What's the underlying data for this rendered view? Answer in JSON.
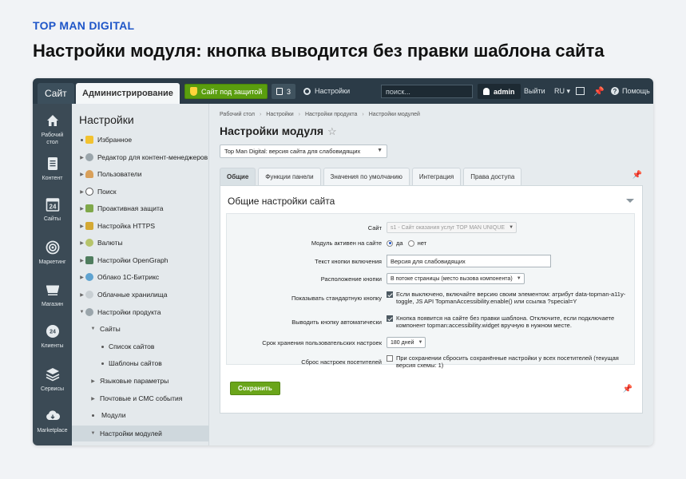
{
  "brand": "TOP MAN DIGITAL",
  "headline": "Настройки модуля: кнопка выводится без правки шаблона сайта",
  "topbar": {
    "site_tab": "Сайт",
    "admin_tab": "Администрирование",
    "secure_button": "Сайт под защитой",
    "notifications_count": "3",
    "settings_link": "Настройки",
    "search_placeholder": "поиск...",
    "user": "admin",
    "logout": "Выйти",
    "lang": "RU",
    "help": "Помощь"
  },
  "rail": [
    {
      "label": "Рабочий стол",
      "icon": "home-icon"
    },
    {
      "label": "Контент",
      "icon": "document-icon"
    },
    {
      "label": "Сайты",
      "icon": "calendar-icon"
    },
    {
      "label": "Маркетинг",
      "icon": "target-icon"
    },
    {
      "label": "Магазин",
      "icon": "cart-icon"
    },
    {
      "label": "Клиенты",
      "icon": "clients-icon"
    },
    {
      "label": "Сервисы",
      "icon": "layers-icon"
    },
    {
      "label": "Marketplace",
      "icon": "cloud-icon"
    }
  ],
  "rail_calendar_day": "24",
  "rail_clients_badge": "24",
  "menu": {
    "title": "Настройки",
    "items": [
      {
        "label": "Избранное"
      },
      {
        "label": "Редактор для контент-менеджеров"
      },
      {
        "label": "Пользователи"
      },
      {
        "label": "Поиск"
      },
      {
        "label": "Проактивная защита"
      },
      {
        "label": "Настройка HTTPS"
      },
      {
        "label": "Валюты"
      },
      {
        "label": "Настройки OpenGraph"
      },
      {
        "label": "Облако 1С-Битрикс"
      },
      {
        "label": "Облачные хранилища"
      },
      {
        "label": "Настройки продукта"
      },
      {
        "label": "Сайты"
      },
      {
        "label": "Список сайтов"
      },
      {
        "label": "Шаблоны сайтов"
      },
      {
        "label": "Языковые параметры"
      },
      {
        "label": "Почтовые и СМС события"
      },
      {
        "label": "Модули"
      },
      {
        "label": "Настройки модулей"
      }
    ]
  },
  "breadcrumbs": [
    "Рабочий стол",
    "Настройки",
    "Настройки продукта",
    "Настройки модулей"
  ],
  "page_title": "Настройки модуля",
  "module_select": "Top Man Digital: версия сайта для слабовидящих",
  "tabs": [
    "Общие",
    "Функции панели",
    "Значения по умолчанию",
    "Интеграция",
    "Права доступа"
  ],
  "section_title": "Общие настройки сайта",
  "form": {
    "site_label": "Сайт",
    "site_value": "s1 - Сайт оказания услуг TOP MAN UNIQUE",
    "active_label": "Модуль активен на сайте",
    "active_yes": "да",
    "active_no": "нет",
    "button_text_label": "Текст кнопки включения",
    "button_text_value": "Версия для слабовидящих",
    "position_label": "Расположение кнопки",
    "position_value": "В потоке страницы (место вызова компонента)",
    "show_std_label": "Показывать стандартную кнопку",
    "show_std_desc": "Если выключено, включайте версию своим элементом: атрибут data-topman-a11y-toggle, JS API TopmanAccessibility.enable() или ссылка ?special=Y",
    "auto_label": "Выводить кнопку автоматически",
    "auto_desc": "Кнопка появится на сайте без правки шаблона. Отключите, если подключаете компонент topman:accessibility.widget вручную в нужном месте.",
    "storage_label": "Срок хранения пользовательских настроек",
    "storage_value": "180 дней",
    "reset_label": "Сброс настроек посетителей",
    "reset_desc": "При сохранении сбросить сохранённые настройки у всех посетителей (текущая версия схемы: 1)"
  },
  "save_button": "Сохранить"
}
